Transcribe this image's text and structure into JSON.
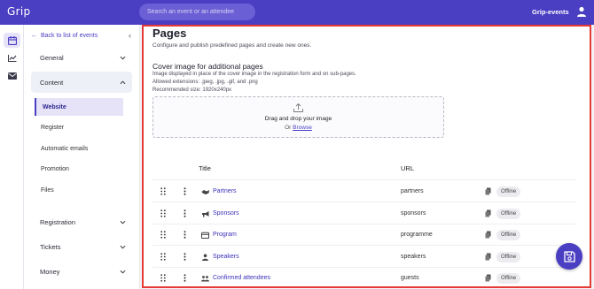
{
  "app": {
    "logo_text": "Grip",
    "search_placeholder": "Search an event or an attendee",
    "org_name": "Grip-events"
  },
  "colors": {
    "brand": "#4a3ec2",
    "highlight_border": "#e53935",
    "active_bg": "#e6e3f8"
  },
  "sidebar": {
    "back_label": "Back to list of events",
    "sections": [
      {
        "label": "General",
        "state": "collapsed"
      },
      {
        "label": "Content",
        "state": "expanded"
      },
      {
        "label": "Registration",
        "state": "collapsed"
      },
      {
        "label": "Tickets",
        "state": "collapsed"
      },
      {
        "label": "Money",
        "state": "collapsed"
      }
    ],
    "content_items": [
      "Website",
      "Register",
      "Automatic emails",
      "Promotion",
      "Files"
    ]
  },
  "main": {
    "title": "Pages",
    "description": "Configure and publish predefined pages and create new ones.",
    "cover": {
      "heading": "Cover image for additional pages",
      "line1": "Image displayed in place of the cover image in the registration form and on sub-pages.",
      "line2": "Allowed extensions: .jpeg, .jpg, .gif, and .png",
      "line3": "Recommended size: 1920x240px",
      "drop_title": "Drag and drop your image",
      "or_label": "Or",
      "browse_label": "Browse"
    },
    "table": {
      "col_title": "Title",
      "col_url": "URL",
      "rows": [
        {
          "title": "Partners",
          "url": "partners",
          "status": "Offline",
          "icon": "handshake-icon"
        },
        {
          "title": "Sponsors",
          "url": "sponsors",
          "status": "Offline",
          "icon": "megaphone-icon"
        },
        {
          "title": "Program",
          "url": "programme",
          "status": "Offline",
          "icon": "calendar-icon"
        },
        {
          "title": "Speakers",
          "url": "speakers",
          "status": "Offline",
          "icon": "person-icon"
        },
        {
          "title": "Confirmed attendees",
          "url": "guests",
          "status": "Offline",
          "icon": "group-icon"
        }
      ]
    }
  }
}
